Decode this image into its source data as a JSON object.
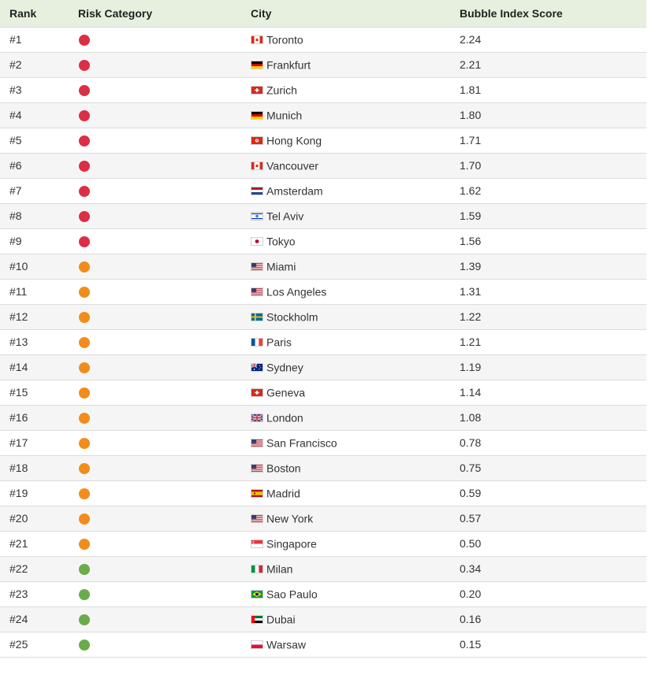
{
  "table": {
    "headers": {
      "rank": "Rank",
      "risk": "Risk Category",
      "city": "City",
      "score": "Bubble Index Score"
    },
    "risk_colors": {
      "high": "#dc2f45",
      "medium": "#f28c1b",
      "low": "#6aac4a"
    },
    "rows": [
      {
        "rank": "#1",
        "risk": "high",
        "city": "Toronto",
        "flag": "canada-flag-icon",
        "score": "2.24"
      },
      {
        "rank": "#2",
        "risk": "high",
        "city": "Frankfurt",
        "flag": "germany-flag-icon",
        "score": "2.21"
      },
      {
        "rank": "#3",
        "risk": "high",
        "city": "Zurich",
        "flag": "switzerland-flag-icon",
        "score": "1.81"
      },
      {
        "rank": "#4",
        "risk": "high",
        "city": "Munich",
        "flag": "germany-flag-icon",
        "score": "1.80"
      },
      {
        "rank": "#5",
        "risk": "high",
        "city": "Hong Kong",
        "flag": "hong-kong-flag-icon",
        "score": "1.71"
      },
      {
        "rank": "#6",
        "risk": "high",
        "city": "Vancouver",
        "flag": "canada-flag-icon",
        "score": "1.70"
      },
      {
        "rank": "#7",
        "risk": "high",
        "city": "Amsterdam",
        "flag": "netherlands-flag-icon",
        "score": "1.62"
      },
      {
        "rank": "#8",
        "risk": "high",
        "city": "Tel Aviv",
        "flag": "israel-flag-icon",
        "score": "1.59"
      },
      {
        "rank": "#9",
        "risk": "high",
        "city": "Tokyo",
        "flag": "japan-flag-icon",
        "score": "1.56"
      },
      {
        "rank": "#10",
        "risk": "medium",
        "city": "Miami",
        "flag": "usa-flag-icon",
        "score": "1.39"
      },
      {
        "rank": "#11",
        "risk": "medium",
        "city": "Los Angeles",
        "flag": "usa-flag-icon",
        "score": "1.31"
      },
      {
        "rank": "#12",
        "risk": "medium",
        "city": "Stockholm",
        "flag": "sweden-flag-icon",
        "score": "1.22"
      },
      {
        "rank": "#13",
        "risk": "medium",
        "city": "Paris",
        "flag": "france-flag-icon",
        "score": "1.21"
      },
      {
        "rank": "#14",
        "risk": "medium",
        "city": "Sydney",
        "flag": "australia-flag-icon",
        "score": "1.19"
      },
      {
        "rank": "#15",
        "risk": "medium",
        "city": "Geneva",
        "flag": "switzerland-flag-icon",
        "score": "1.14"
      },
      {
        "rank": "#16",
        "risk": "medium",
        "city": "London",
        "flag": "uk-flag-icon",
        "score": "1.08"
      },
      {
        "rank": "#17",
        "risk": "medium",
        "city": "San Francisco",
        "flag": "usa-flag-icon",
        "score": "0.78"
      },
      {
        "rank": "#18",
        "risk": "medium",
        "city": "Boston",
        "flag": "usa-flag-icon",
        "score": "0.75"
      },
      {
        "rank": "#19",
        "risk": "medium",
        "city": "Madrid",
        "flag": "spain-flag-icon",
        "score": "0.59"
      },
      {
        "rank": "#20",
        "risk": "medium",
        "city": "New York",
        "flag": "usa-flag-icon",
        "score": "0.57"
      },
      {
        "rank": "#21",
        "risk": "medium",
        "city": "Singapore",
        "flag": "singapore-flag-icon",
        "score": "0.50"
      },
      {
        "rank": "#22",
        "risk": "low",
        "city": "Milan",
        "flag": "italy-flag-icon",
        "score": "0.34"
      },
      {
        "rank": "#23",
        "risk": "low",
        "city": "Sao Paulo",
        "flag": "brazil-flag-icon",
        "score": "0.20"
      },
      {
        "rank": "#24",
        "risk": "low",
        "city": "Dubai",
        "flag": "uae-flag-icon",
        "score": "0.16"
      },
      {
        "rank": "#25",
        "risk": "low",
        "city": "Warsaw",
        "flag": "poland-flag-icon",
        "score": "0.15"
      }
    ]
  }
}
